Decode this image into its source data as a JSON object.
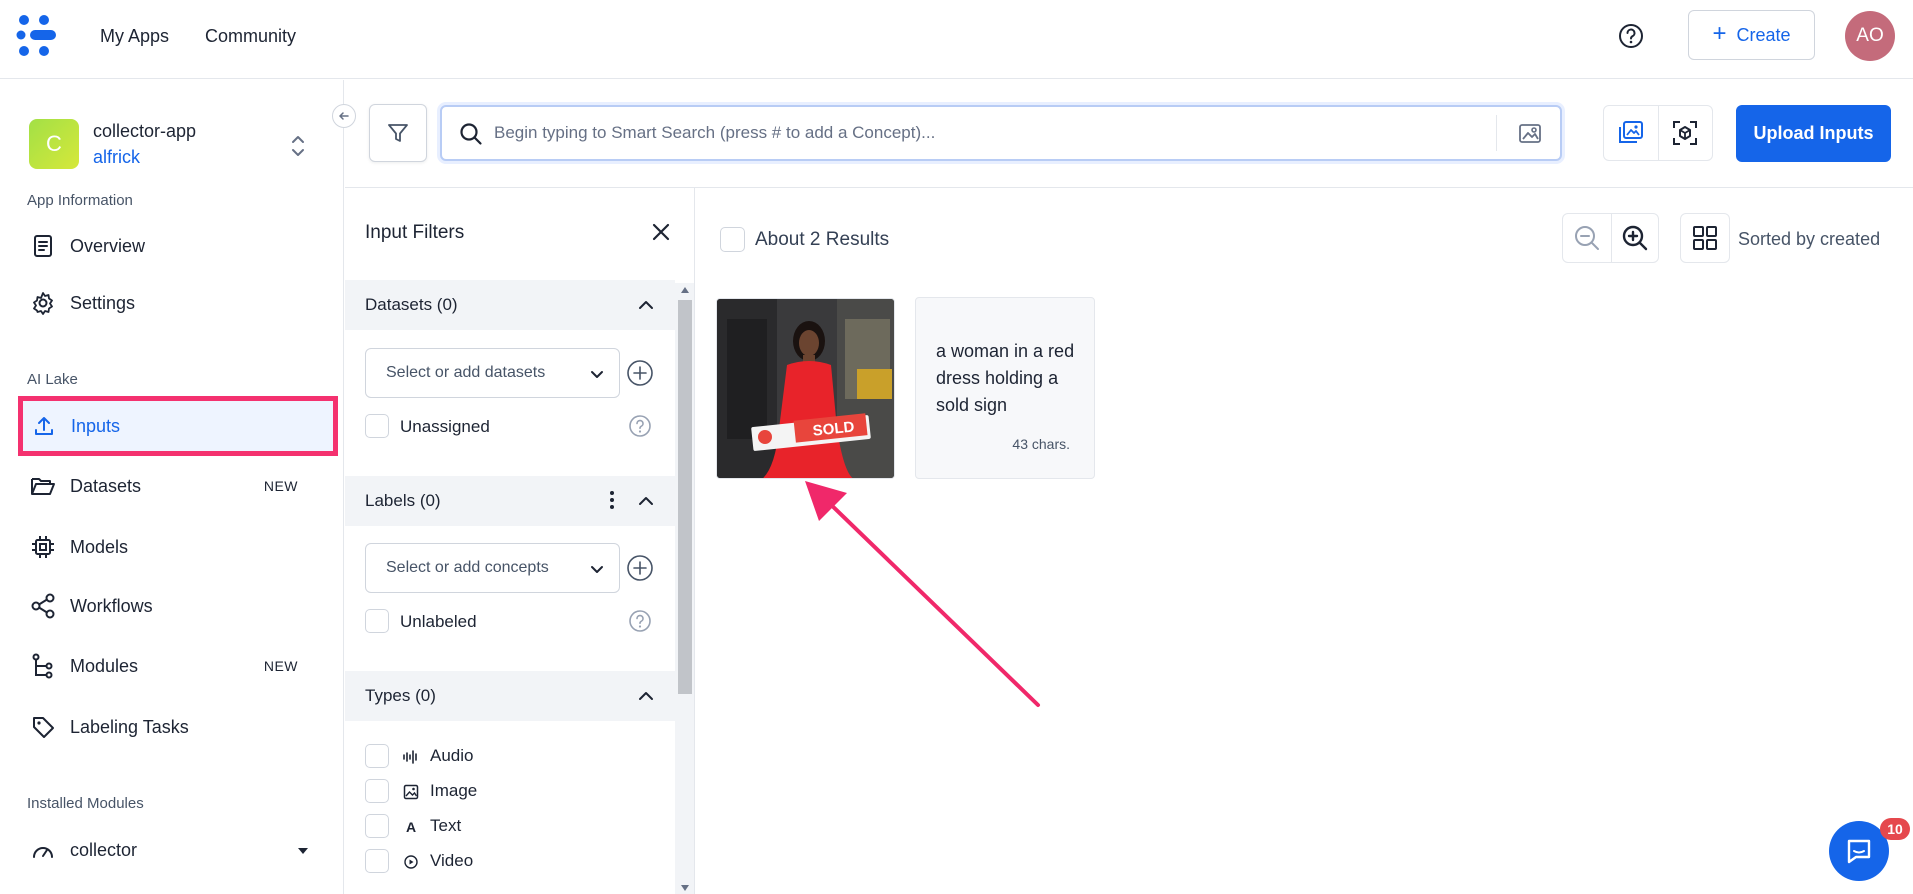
{
  "topnav": {
    "my_apps": "My Apps",
    "community": "Community",
    "create_label": "Create",
    "avatar_initials": "AO"
  },
  "app": {
    "initial": "C",
    "name": "collector-app",
    "user": "alfrick"
  },
  "sidebar": {
    "section_app_info": "App Information",
    "overview": "Overview",
    "settings": "Settings",
    "section_ai_lake": "AI Lake",
    "inputs": "Inputs",
    "datasets": "Datasets",
    "datasets_badge": "NEW",
    "models": "Models",
    "workflows": "Workflows",
    "modules": "Modules",
    "modules_badge": "NEW",
    "labeling_tasks": "Labeling Tasks",
    "section_installed": "Installed Modules",
    "installed_item": "collector"
  },
  "toolbar": {
    "search_placeholder": "Begin typing to Smart Search (press # to add a Concept)...",
    "search_value": "",
    "upload_label": "Upload Inputs"
  },
  "filters": {
    "title": "Input Filters",
    "datasets_head": "Datasets (0)",
    "datasets_select": "Select or add datasets",
    "unassigned": "Unassigned",
    "labels_head": "Labels (0)",
    "concepts_select": "Select or add concepts",
    "unlabeled": "Unlabeled",
    "types_head": "Types (0)",
    "types": [
      "Audio",
      "Image",
      "Text",
      "Video"
    ]
  },
  "results": {
    "count_label": "About 2 Results",
    "sorted_label": "Sorted by created",
    "sign_text": "SOLD",
    "text_card": "a woman in a red dress holding a sold sign",
    "text_chars": "43 chars."
  },
  "chat": {
    "badge": "10"
  },
  "colors": {
    "brand_blue": "#1565e9",
    "highlight_pink": "#f4316f",
    "badge_red": "#e5484d"
  },
  "icons": {
    "logo": "clarifai-logo-icon",
    "help": "help-circle-icon",
    "filter": "filter-funnel-icon",
    "search": "search-icon",
    "image_search": "image-search-icon",
    "zoom_out": "zoom-out-icon",
    "zoom_in": "zoom-in-icon",
    "grid": "grid-view-icon",
    "chat": "chat-icon"
  }
}
